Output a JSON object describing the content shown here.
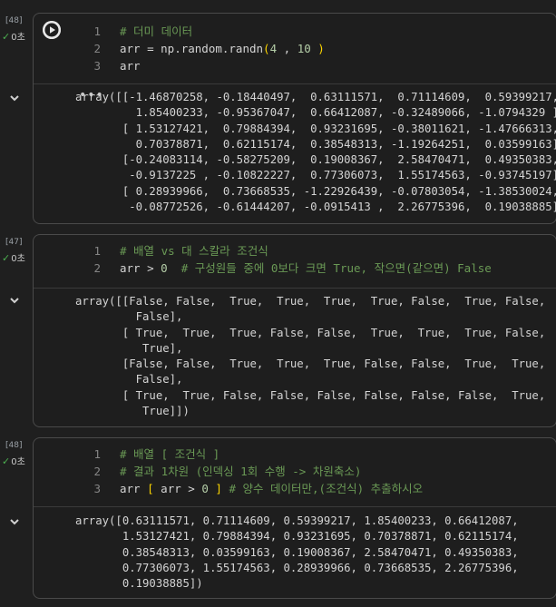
{
  "cells": [
    {
      "exec_count": "[48]",
      "status": "0초",
      "code": [
        {
          "ln": "1",
          "parts": [
            {
              "t": "# 더미 데이터",
              "c": "comment"
            }
          ]
        },
        {
          "ln": "2",
          "parts": [
            {
              "t": "arr = np.random.randn",
              "c": "default"
            },
            {
              "t": "(",
              "c": "bracket"
            },
            {
              "t": "4",
              "c": "number"
            },
            {
              "t": " , ",
              "c": "default"
            },
            {
              "t": "10",
              "c": "number"
            },
            {
              "t": " )",
              "c": "bracket"
            }
          ]
        },
        {
          "ln": "3",
          "parts": [
            {
              "t": "arr",
              "c": "default"
            }
          ]
        }
      ],
      "output": "array([[-1.46870258, -0.18440497,  0.63111571,  0.71114609,  0.59399217,\n         1.85400233, -0.95367047,  0.66412087, -0.32489066, -1.0794329 ],\n       [ 1.53127421,  0.79884394,  0.93231695, -0.38011621, -1.47666313,\n         0.70378871,  0.62115174,  0.38548313, -1.19264251,  0.03599163],\n       [-0.24083114, -0.58275209,  0.19008367,  2.58470471,  0.49350383,\n        -0.9137225 , -0.10822227,  0.77306073,  1.55174563, -0.93745197],\n       [ 0.28939966,  0.73668535, -1.22926439, -0.07803054, -1.38530024,\n        -0.08772526, -0.61444207, -0.0915413 ,  2.26775396,  0.19038885]])"
    },
    {
      "exec_count": "[47]",
      "status": "0초",
      "code": [
        {
          "ln": "1",
          "parts": [
            {
              "t": "# 배열 vs 대 스칼라 조건식",
              "c": "comment"
            }
          ]
        },
        {
          "ln": "2",
          "parts": [
            {
              "t": "arr > ",
              "c": "default"
            },
            {
              "t": "0",
              "c": "number"
            },
            {
              "t": "  # 구성원들 중에 0보다 크면 True, 작으면(같으면) False",
              "c": "comment"
            }
          ]
        }
      ],
      "output": "array([[False, False,  True,  True,  True,  True, False,  True, False,\n         False],\n       [ True,  True,  True, False, False,  True,  True,  True, False,\n          True],\n       [False, False,  True,  True,  True, False, False,  True,  True,\n         False],\n       [ True,  True, False, False, False, False, False, False,  True,\n          True]])"
    },
    {
      "exec_count": "[48]",
      "status": "0초",
      "code": [
        {
          "ln": "1",
          "parts": [
            {
              "t": "# 배열 [ 조건식 ]",
              "c": "comment"
            }
          ]
        },
        {
          "ln": "2",
          "parts": [
            {
              "t": "# 결과 1차원 (인덱싱 1회 수행 -> 차원축소)",
              "c": "comment"
            }
          ]
        },
        {
          "ln": "3",
          "parts": [
            {
              "t": "arr ",
              "c": "default"
            },
            {
              "t": "[",
              "c": "bracket"
            },
            {
              "t": " arr > ",
              "c": "default"
            },
            {
              "t": "0",
              "c": "number"
            },
            {
              "t": " ]",
              "c": "bracket"
            },
            {
              "t": " # 양수 데이터만,(조건식) 추출하시오",
              "c": "comment"
            }
          ]
        }
      ],
      "output": "array([0.63111571, 0.71114609, 0.59399217, 1.85400233, 0.66412087,\n       1.53127421, 0.79884394, 0.93231695, 0.70378871, 0.62115174,\n       0.38548313, 0.03599163, 0.19008367, 2.58470471, 0.49350383,\n       0.77306073, 1.55174563, 0.28939966, 0.73668535, 2.26775396,\n       0.19038885])"
    }
  ]
}
